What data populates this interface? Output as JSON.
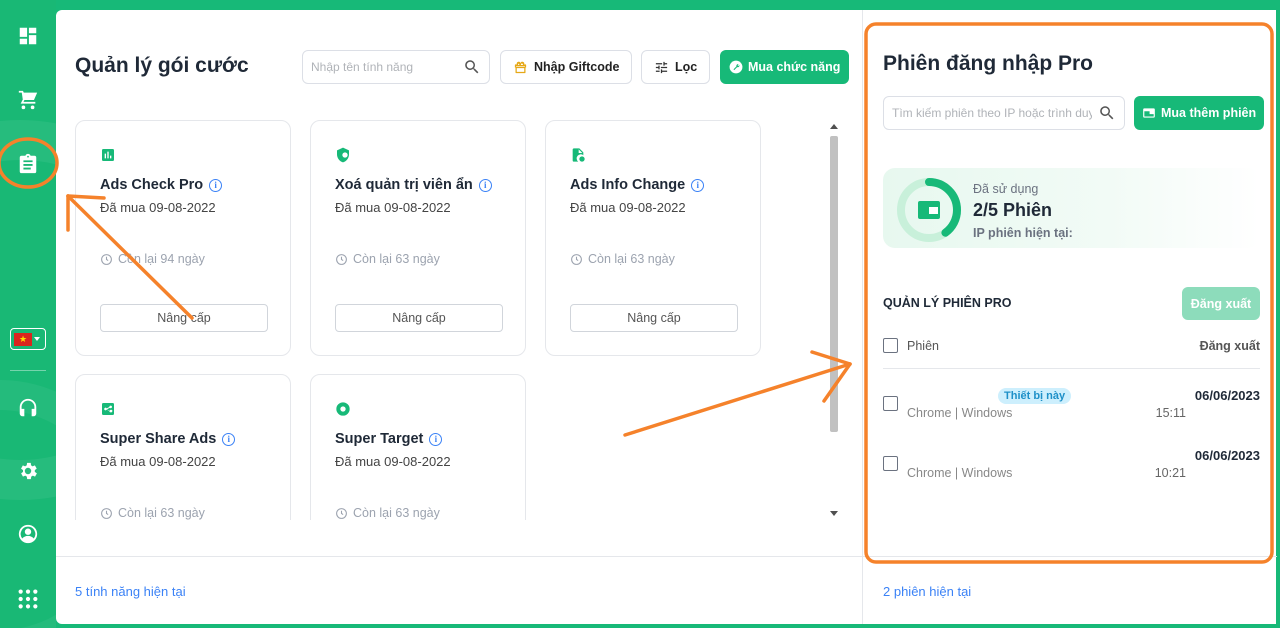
{
  "main": {
    "title": "Quản lý gói cước",
    "search_placeholder": "Nhập tên tính năng",
    "giftcode_label": "Nhập Giftcode",
    "filter_label": "Lọc",
    "buy_feature_label": "Mua chức năng",
    "cards": [
      {
        "title": "Ads Check Pro",
        "date": "Đã mua 09-08-2022",
        "remaining": "Còn lại 94 ngày",
        "button": "Nâng cấp",
        "icon": "chart-icon"
      },
      {
        "title": "Xoá quản trị viên ẩn",
        "date": "Đã mua 09-08-2022",
        "remaining": "Còn lại 63 ngày",
        "button": "Nâng cấp",
        "icon": "shield-icon"
      },
      {
        "title": "Ads Info Change",
        "date": "Đã mua 09-08-2022",
        "remaining": "Còn lại 63 ngày",
        "button": "Nâng cấp",
        "icon": "file-icon"
      },
      {
        "title": "Super Share Ads",
        "date": "Đã mua 09-08-2022",
        "remaining": "Còn lại 63 ngày",
        "button": "Nâng cấp",
        "icon": "share-icon"
      },
      {
        "title": "Super Target",
        "date": "Đã mua 09-08-2022",
        "remaining": "Còn lại 63 ngày",
        "button": "Nâng cấp",
        "icon": "target-icon"
      }
    ],
    "footer": "5 tính năng hiện tại"
  },
  "right": {
    "title": "Phiên đăng nhập Pro",
    "search_placeholder": "Tìm kiếm phiên theo IP hoặc trình duyệt",
    "buy_label": "Mua thêm phiên",
    "usage": {
      "label": "Đã sử dụng",
      "value": "2/5 Phiên",
      "ip_label": "IP phiên hiện tại:",
      "used": 2,
      "total": 5
    },
    "section_title": "QUẢN LÝ PHIÊN PRO",
    "logout_label": "Đăng xuất",
    "table": {
      "col_session": "Phiên",
      "col_logout": "Đăng xuất"
    },
    "sessions": [
      {
        "badge": "Thiết bị này",
        "device": "Chrome | Windows",
        "date": "06/06/2023",
        "time": "15:11"
      },
      {
        "badge": "",
        "device": "Chrome | Windows",
        "date": "06/06/2023",
        "time": "10:21"
      }
    ],
    "footer": "2 phiên hiện tại"
  },
  "colors": {
    "brand": "#17b978",
    "annotation": "#f5822b",
    "link": "#3b82f6"
  }
}
